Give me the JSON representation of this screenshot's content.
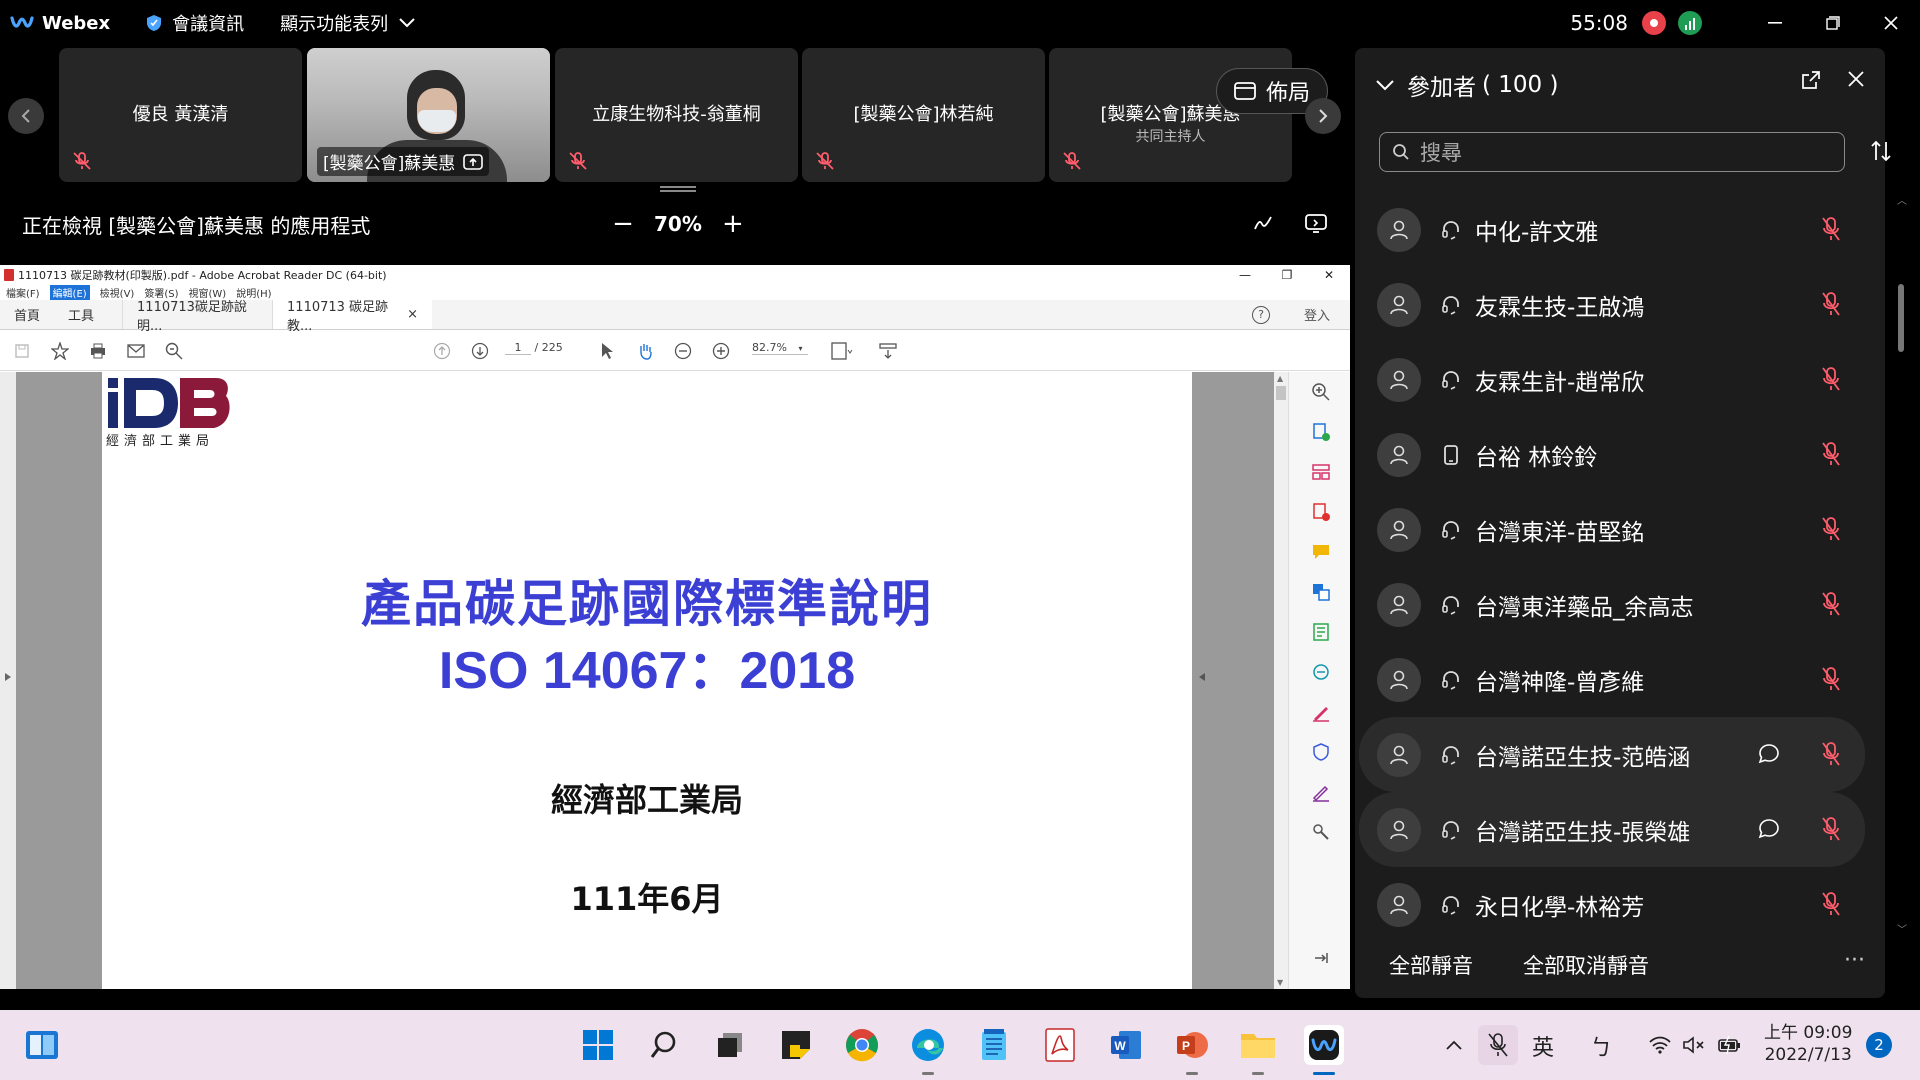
{
  "app": {
    "name": "Webex"
  },
  "topbar": {
    "meeting_info": "會議資訊",
    "menu_toggle": "顯示功能表列",
    "timer": "55:08"
  },
  "strip": {
    "layout_label": "佈局",
    "tiles": [
      {
        "name": "優良 黃漢清",
        "sub": ""
      },
      {
        "name": "[製藥公會]蘇美惠",
        "sub": ""
      },
      {
        "name": "立康生物科技-翁董桐",
        "sub": ""
      },
      {
        "name": "[製藥公會]林若純",
        "sub": ""
      },
      {
        "name": "[製藥公會]蘇美惠",
        "sub": "共同主持人"
      }
    ]
  },
  "share": {
    "status": "正在檢視 [製藥公會]蘇美惠 的應用程式",
    "zoom": "70%",
    "zoom_out": "−",
    "zoom_in": "+"
  },
  "acrobat": {
    "title": "1110713 碳足跡教材(印製版).pdf - Adobe Acrobat Reader DC (64-bit)",
    "menu": [
      "檔案(F)",
      "編輯(E)",
      "檢視(V)",
      "簽署(S)",
      "視窗(W)",
      "說明(H)"
    ],
    "tab_home": "首頁",
    "tab_tools": "工具",
    "doc_tabs": [
      "1110713碳足跡說明...",
      "1110713 碳足跡教..."
    ],
    "close_tab": "×",
    "login": "登入",
    "help": "?",
    "page_current": "1",
    "page_total": "/ 225",
    "zoom": "82.7%",
    "page": {
      "logo_text": "經濟部工業局",
      "title_line1": "產品碳足跡國際標準說明",
      "title_line2": "ISO 14067：2018",
      "org": "經濟部工業局",
      "date": "111年6月"
    }
  },
  "participants": {
    "header": "參加者",
    "count": "( 100 )",
    "search_placeholder": "搜尋",
    "list": [
      {
        "name": "中化-許文雅",
        "type": "headset-icon",
        "chat": false
      },
      {
        "name": "友霖生技-王啟鴻",
        "type": "headset-icon",
        "chat": false
      },
      {
        "name": "友霖生計-趙常欣",
        "type": "headset-icon",
        "chat": false
      },
      {
        "name": "台裕 林鈴鈴",
        "type": "phone-icon",
        "chat": false
      },
      {
        "name": "台灣東洋-苗堅銘",
        "type": "headset-icon",
        "chat": false
      },
      {
        "name": "台灣東洋藥品_余高志",
        "type": "headset-icon",
        "chat": false
      },
      {
        "name": "台灣神隆-曾彥維",
        "type": "headset-icon",
        "chat": false
      },
      {
        "name": "台灣諾亞生技-范皓涵",
        "type": "headset-icon",
        "chat": true
      },
      {
        "name": "台灣諾亞生技-張榮雄",
        "type": "headset-icon",
        "chat": true
      },
      {
        "name": "永日化學-林裕芳",
        "type": "headset-icon",
        "chat": false
      }
    ],
    "mute_all": "全部靜音",
    "unmute_all": "全部取消靜音",
    "more": "···"
  },
  "taskbar": {
    "ime": "英",
    "ime2": "ㄅ",
    "time": "上午 09:09",
    "date": "2022/7/13",
    "notifications": "2"
  },
  "colors": {
    "accent_blue": "#3b3fd4",
    "mute_red": "#ff5c6c",
    "record_red": "#e8414a"
  }
}
